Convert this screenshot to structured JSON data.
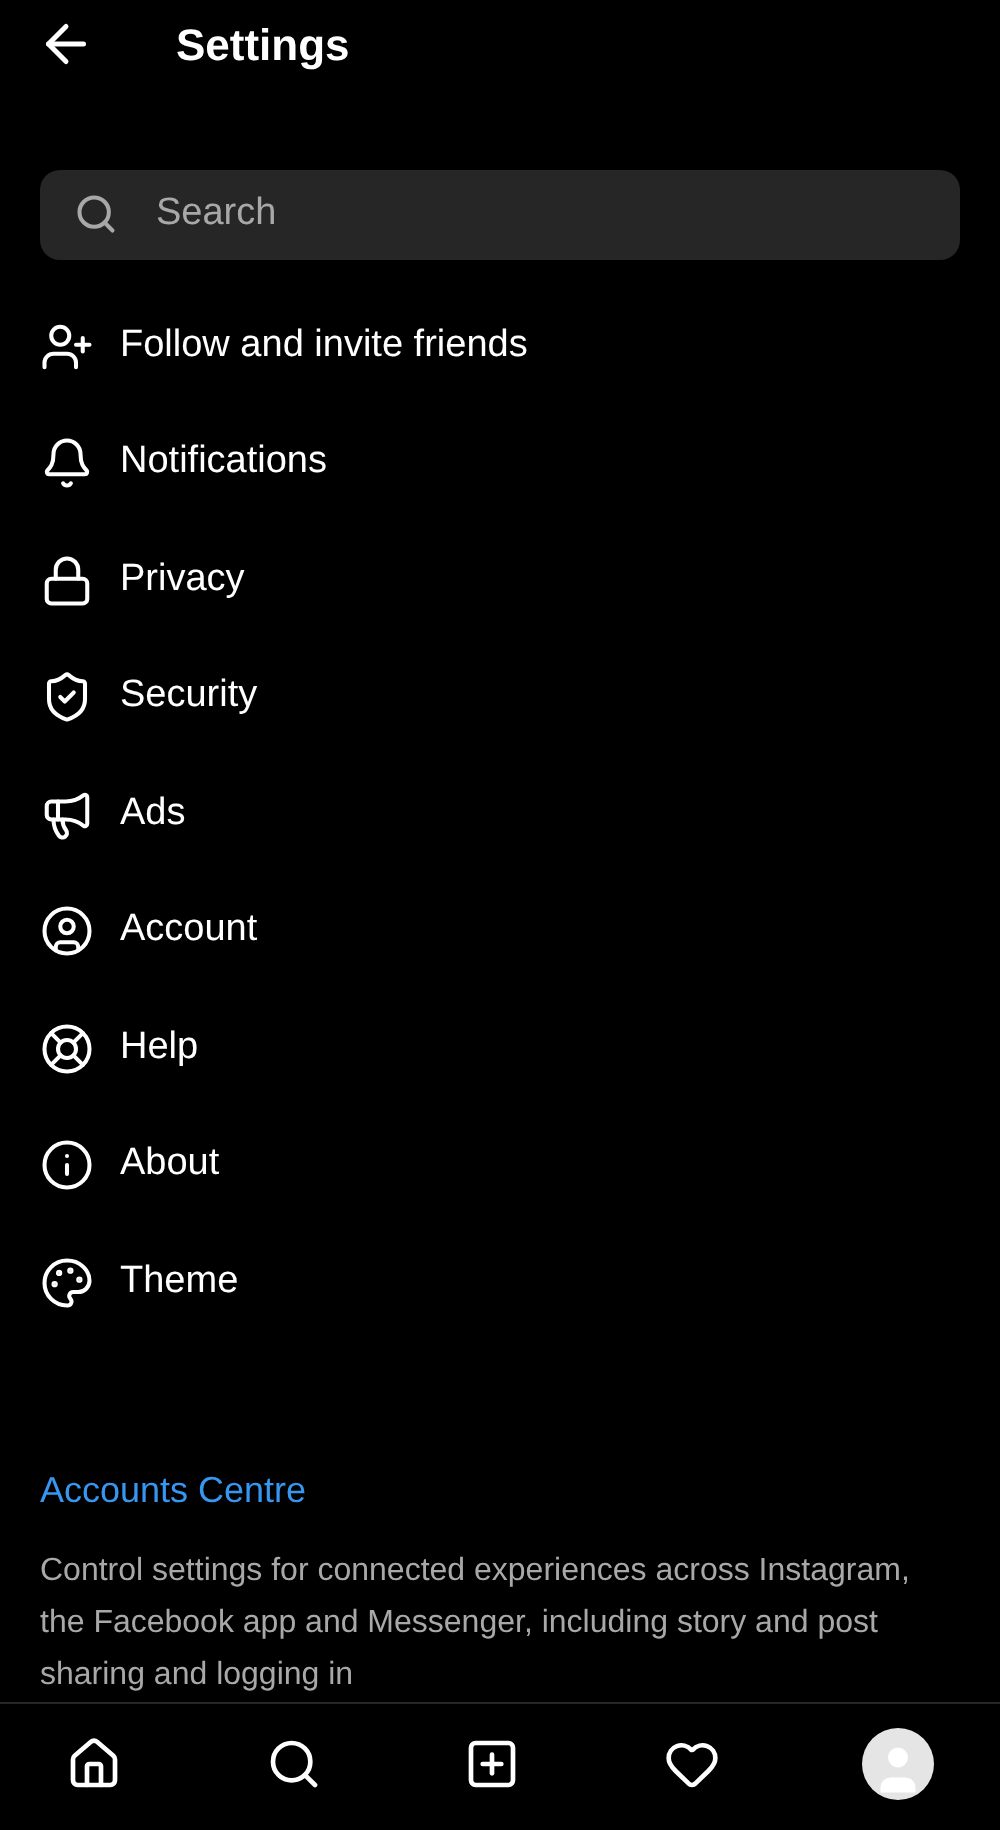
{
  "header": {
    "title": "Settings"
  },
  "search": {
    "placeholder": "Search"
  },
  "menu": [
    {
      "label": "Follow and invite friends"
    },
    {
      "label": "Notifications"
    },
    {
      "label": "Privacy"
    },
    {
      "label": "Security"
    },
    {
      "label": "Ads"
    },
    {
      "label": "Account"
    },
    {
      "label": "Help"
    },
    {
      "label": "About"
    },
    {
      "label": "Theme"
    }
  ],
  "accounts_centre": {
    "title": "Accounts Centre",
    "description": "Control settings for connected experiences across Instagram, the Facebook app and Messenger, including story and post sharing and logging in"
  },
  "bottom_nav": [
    {
      "kind": "home"
    },
    {
      "kind": "search"
    },
    {
      "kind": "create"
    },
    {
      "kind": "activity"
    },
    {
      "kind": "profile"
    }
  ]
}
